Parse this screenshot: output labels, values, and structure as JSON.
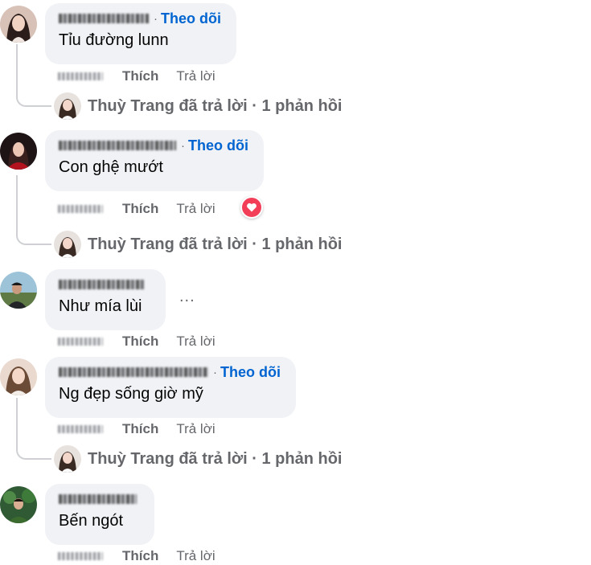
{
  "comments": [
    {
      "follow_label": "Theo dõi",
      "text": "Tỉu đường lunn",
      "like_label": "Thích",
      "reply_label": "Trả lời",
      "replies_summary": "Thuỳ Trang đã trả lời · 1 phản hồi"
    },
    {
      "follow_label": "Theo dõi",
      "text": "Con ghệ mướt",
      "like_label": "Thích",
      "reply_label": "Trả lời",
      "reaction_icon": "heart-reaction-icon",
      "replies_summary": "Thuỳ Trang đã trả lời · 1 phản hồi"
    },
    {
      "text": "Như mía lùi",
      "like_label": "Thích",
      "reply_label": "Trả lời",
      "more_label": "..."
    },
    {
      "follow_label": "Theo dõi",
      "text": "Ng đẹp sống giờ mỹ",
      "like_label": "Thích",
      "reply_label": "Trả lời",
      "replies_summary": "Thuỳ Trang đã trả lời · 1 phản hồi"
    },
    {
      "text": "Bến ngót",
      "like_label": "Thích",
      "reply_label": "Trả lời"
    }
  ],
  "colors": {
    "bubble_bg": "#f0f2f5",
    "follow_link": "#0064d1",
    "meta_text": "#65676b",
    "reaction_heart": "#f33e58",
    "thread_line": "#ced0d4"
  }
}
